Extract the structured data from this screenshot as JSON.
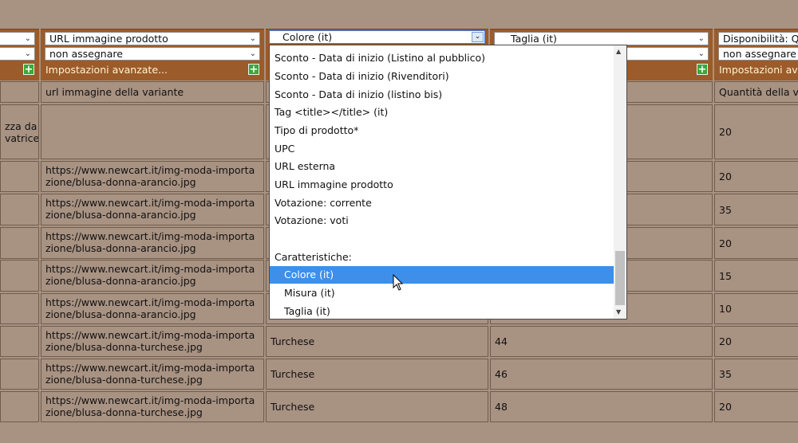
{
  "columns": [
    {
      "select1": "",
      "select2": "",
      "advanced": "",
      "header_cell": "",
      "rows": [
        "zza da\nvatrice.",
        "",
        "",
        "",
        "",
        "",
        "",
        "",
        ""
      ]
    },
    {
      "select1": "URL immagine prodotto",
      "select2": "non assegnare",
      "advanced": "Impostazioni avanzate...",
      "header_cell": "url immagine della variante",
      "rows": [
        "",
        "https://www.newcart.it/img-moda-importazione/blusa-donna-arancio.jpg",
        "https://www.newcart.it/img-moda-importazione/blusa-donna-arancio.jpg",
        "https://www.newcart.it/img-moda-importazione/blusa-donna-arancio.jpg",
        "https://www.newcart.it/img-moda-importazione/blusa-donna-arancio.jpg",
        "https://www.newcart.it/img-moda-importazione/blusa-donna-arancio.jpg",
        "https://www.newcart.it/img-moda-importazione/blusa-donna-turchese.jpg",
        "https://www.newcart.it/img-moda-importazione/blusa-donna-turchese.jpg",
        "https://www.newcart.it/img-moda-importazione/blusa-donna-turchese.jpg"
      ]
    },
    {
      "select1": "Colore (it)",
      "rows": [
        "",
        "",
        "",
        "",
        "",
        "",
        "Turchese",
        "Turchese",
        "Turchese"
      ]
    },
    {
      "select1": "Taglia (it)",
      "select2": "",
      "rows": [
        "",
        "",
        "",
        "",
        "",
        "",
        "44",
        "46",
        "48"
      ]
    },
    {
      "select1": "Disponibilità: Q",
      "select2": "non assegnare",
      "advanced": "Impostazioni avanzate",
      "header_cell": "Quantità della v",
      "rows": [
        "20",
        "20",
        "35",
        "20",
        "15",
        "10",
        "20",
        "35",
        "20"
      ]
    }
  ],
  "dropdown": {
    "items": [
      {
        "label": "Sconto - Data di inizio (Listino al pubblico)",
        "sub": false
      },
      {
        "label": "Sconto - Data di inizio (Rivenditori)",
        "sub": false
      },
      {
        "label": "Sconto - Data di inizio (listino bis)",
        "sub": false
      },
      {
        "label": "Tag <title></title> (it)",
        "sub": false
      },
      {
        "label": "Tipo di prodotto*",
        "sub": false
      },
      {
        "label": "UPC",
        "sub": false
      },
      {
        "label": "URL esterna",
        "sub": false
      },
      {
        "label": "URL immagine prodotto",
        "sub": false
      },
      {
        "label": "Votazione: corrente",
        "sub": false
      },
      {
        "label": "Votazione: voti",
        "sub": false
      },
      {
        "label": "",
        "sub": false
      },
      {
        "label": "Caratteristiche:",
        "sub": false
      },
      {
        "label": "Colore (it)",
        "sub": true,
        "highlighted": true
      },
      {
        "label": "Misura (it)",
        "sub": true
      },
      {
        "label": "Taglia (it)",
        "sub": true
      }
    ]
  },
  "colors": {
    "header_bg": "#9b5b2a",
    "cell_bg": "#a89282",
    "highlight": "#3d8fe9",
    "plus_green": "#3aa83a"
  }
}
